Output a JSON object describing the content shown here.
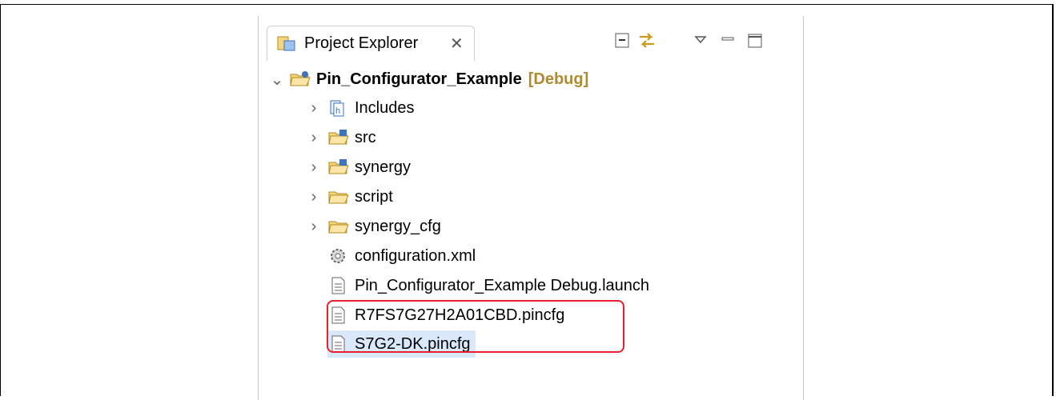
{
  "view": {
    "tab_label": "Project Explorer",
    "tab_close_glyph": "✕",
    "toolbar": [
      "collapse-all-icon",
      "link-with-editor-icon",
      "view-menu-icon",
      "minimize-icon",
      "maximize-icon"
    ]
  },
  "tree": {
    "project": {
      "label": "Pin_Configurator_Example",
      "decoration": "[Debug]"
    },
    "items": [
      {
        "label": "Includes",
        "icon": "includes-icon",
        "expandable": true
      },
      {
        "label": "src",
        "icon": "source-folder-icon",
        "expandable": true
      },
      {
        "label": "synergy",
        "icon": "source-folder-icon",
        "expandable": true
      },
      {
        "label": "script",
        "icon": "folder-icon",
        "expandable": true
      },
      {
        "label": "synergy_cfg",
        "icon": "folder-icon",
        "expandable": true
      },
      {
        "label": "configuration.xml",
        "icon": "gear-file-icon",
        "expandable": false
      },
      {
        "label": "Pin_Configurator_Example Debug.launch",
        "icon": "file-icon",
        "expandable": false
      },
      {
        "label": "R7FS7G27H2A01CBD.pincfg",
        "icon": "file-icon",
        "expandable": false
      },
      {
        "label": "S7G2-DK.pincfg",
        "icon": "file-icon",
        "expandable": false,
        "selected": true
      }
    ]
  },
  "colors": {
    "highlight": "#e8202a",
    "selection": "#d9e8fb",
    "decoration": "#b08a2e"
  }
}
